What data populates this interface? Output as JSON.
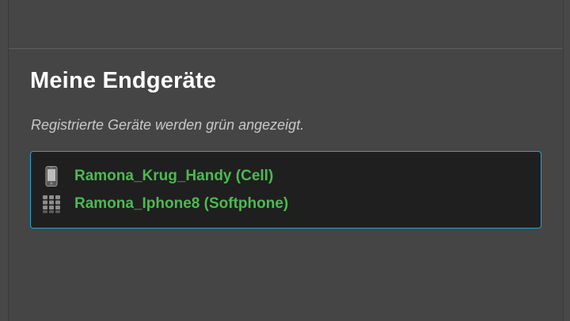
{
  "page": {
    "title": "Meine Endgeräte",
    "subtitle": "Registrierte Geräte werden grün angezeigt."
  },
  "devices": [
    {
      "label": "Ramona_Krug_Handy (Cell)",
      "icon": "cellphone-icon",
      "status_color": "#4bbb4f"
    },
    {
      "label": "Ramona_Iphone8 (Softphone)",
      "icon": "keypad-icon",
      "status_color": "#4bbb4f"
    }
  ],
  "colors": {
    "background": "#454545",
    "box_background": "#1f1f1f",
    "box_border": "#1aa7d8",
    "registered": "#4bbb4f"
  }
}
